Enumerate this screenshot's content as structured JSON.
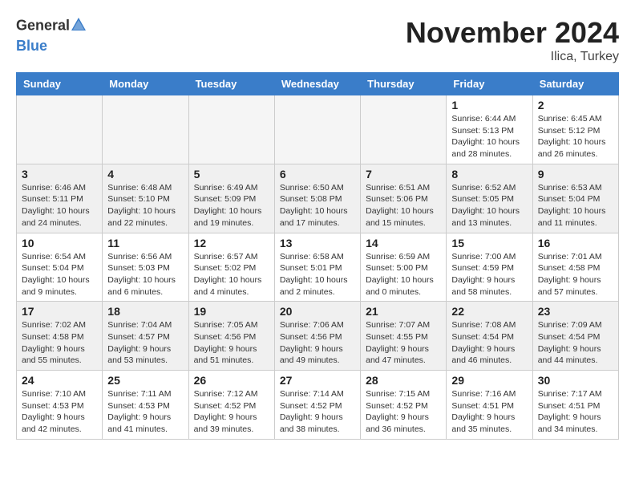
{
  "logo": {
    "general": "General",
    "blue": "Blue"
  },
  "title": "November 2024",
  "location": "Ilica, Turkey",
  "days_of_week": [
    "Sunday",
    "Monday",
    "Tuesday",
    "Wednesday",
    "Thursday",
    "Friday",
    "Saturday"
  ],
  "weeks": [
    [
      {
        "day": "",
        "info": "",
        "empty": true
      },
      {
        "day": "",
        "info": "",
        "empty": true
      },
      {
        "day": "",
        "info": "",
        "empty": true
      },
      {
        "day": "",
        "info": "",
        "empty": true
      },
      {
        "day": "",
        "info": "",
        "empty": true
      },
      {
        "day": "1",
        "info": "Sunrise: 6:44 AM\nSunset: 5:13 PM\nDaylight: 10 hours\nand 28 minutes.",
        "empty": false
      },
      {
        "day": "2",
        "info": "Sunrise: 6:45 AM\nSunset: 5:12 PM\nDaylight: 10 hours\nand 26 minutes.",
        "empty": false
      }
    ],
    [
      {
        "day": "3",
        "info": "Sunrise: 6:46 AM\nSunset: 5:11 PM\nDaylight: 10 hours\nand 24 minutes.",
        "empty": false
      },
      {
        "day": "4",
        "info": "Sunrise: 6:48 AM\nSunset: 5:10 PM\nDaylight: 10 hours\nand 22 minutes.",
        "empty": false
      },
      {
        "day": "5",
        "info": "Sunrise: 6:49 AM\nSunset: 5:09 PM\nDaylight: 10 hours\nand 19 minutes.",
        "empty": false
      },
      {
        "day": "6",
        "info": "Sunrise: 6:50 AM\nSunset: 5:08 PM\nDaylight: 10 hours\nand 17 minutes.",
        "empty": false
      },
      {
        "day": "7",
        "info": "Sunrise: 6:51 AM\nSunset: 5:06 PM\nDaylight: 10 hours\nand 15 minutes.",
        "empty": false
      },
      {
        "day": "8",
        "info": "Sunrise: 6:52 AM\nSunset: 5:05 PM\nDaylight: 10 hours\nand 13 minutes.",
        "empty": false
      },
      {
        "day": "9",
        "info": "Sunrise: 6:53 AM\nSunset: 5:04 PM\nDaylight: 10 hours\nand 11 minutes.",
        "empty": false
      }
    ],
    [
      {
        "day": "10",
        "info": "Sunrise: 6:54 AM\nSunset: 5:04 PM\nDaylight: 10 hours\nand 9 minutes.",
        "empty": false
      },
      {
        "day": "11",
        "info": "Sunrise: 6:56 AM\nSunset: 5:03 PM\nDaylight: 10 hours\nand 6 minutes.",
        "empty": false
      },
      {
        "day": "12",
        "info": "Sunrise: 6:57 AM\nSunset: 5:02 PM\nDaylight: 10 hours\nand 4 minutes.",
        "empty": false
      },
      {
        "day": "13",
        "info": "Sunrise: 6:58 AM\nSunset: 5:01 PM\nDaylight: 10 hours\nand 2 minutes.",
        "empty": false
      },
      {
        "day": "14",
        "info": "Sunrise: 6:59 AM\nSunset: 5:00 PM\nDaylight: 10 hours\nand 0 minutes.",
        "empty": false
      },
      {
        "day": "15",
        "info": "Sunrise: 7:00 AM\nSunset: 4:59 PM\nDaylight: 9 hours\nand 58 minutes.",
        "empty": false
      },
      {
        "day": "16",
        "info": "Sunrise: 7:01 AM\nSunset: 4:58 PM\nDaylight: 9 hours\nand 57 minutes.",
        "empty": false
      }
    ],
    [
      {
        "day": "17",
        "info": "Sunrise: 7:02 AM\nSunset: 4:58 PM\nDaylight: 9 hours\nand 55 minutes.",
        "empty": false
      },
      {
        "day": "18",
        "info": "Sunrise: 7:04 AM\nSunset: 4:57 PM\nDaylight: 9 hours\nand 53 minutes.",
        "empty": false
      },
      {
        "day": "19",
        "info": "Sunrise: 7:05 AM\nSunset: 4:56 PM\nDaylight: 9 hours\nand 51 minutes.",
        "empty": false
      },
      {
        "day": "20",
        "info": "Sunrise: 7:06 AM\nSunset: 4:56 PM\nDaylight: 9 hours\nand 49 minutes.",
        "empty": false
      },
      {
        "day": "21",
        "info": "Sunrise: 7:07 AM\nSunset: 4:55 PM\nDaylight: 9 hours\nand 47 minutes.",
        "empty": false
      },
      {
        "day": "22",
        "info": "Sunrise: 7:08 AM\nSunset: 4:54 PM\nDaylight: 9 hours\nand 46 minutes.",
        "empty": false
      },
      {
        "day": "23",
        "info": "Sunrise: 7:09 AM\nSunset: 4:54 PM\nDaylight: 9 hours\nand 44 minutes.",
        "empty": false
      }
    ],
    [
      {
        "day": "24",
        "info": "Sunrise: 7:10 AM\nSunset: 4:53 PM\nDaylight: 9 hours\nand 42 minutes.",
        "empty": false
      },
      {
        "day": "25",
        "info": "Sunrise: 7:11 AM\nSunset: 4:53 PM\nDaylight: 9 hours\nand 41 minutes.",
        "empty": false
      },
      {
        "day": "26",
        "info": "Sunrise: 7:12 AM\nSunset: 4:52 PM\nDaylight: 9 hours\nand 39 minutes.",
        "empty": false
      },
      {
        "day": "27",
        "info": "Sunrise: 7:14 AM\nSunset: 4:52 PM\nDaylight: 9 hours\nand 38 minutes.",
        "empty": false
      },
      {
        "day": "28",
        "info": "Sunrise: 7:15 AM\nSunset: 4:52 PM\nDaylight: 9 hours\nand 36 minutes.",
        "empty": false
      },
      {
        "day": "29",
        "info": "Sunrise: 7:16 AM\nSunset: 4:51 PM\nDaylight: 9 hours\nand 35 minutes.",
        "empty": false
      },
      {
        "day": "30",
        "info": "Sunrise: 7:17 AM\nSunset: 4:51 PM\nDaylight: 9 hours\nand 34 minutes.",
        "empty": false
      }
    ]
  ]
}
